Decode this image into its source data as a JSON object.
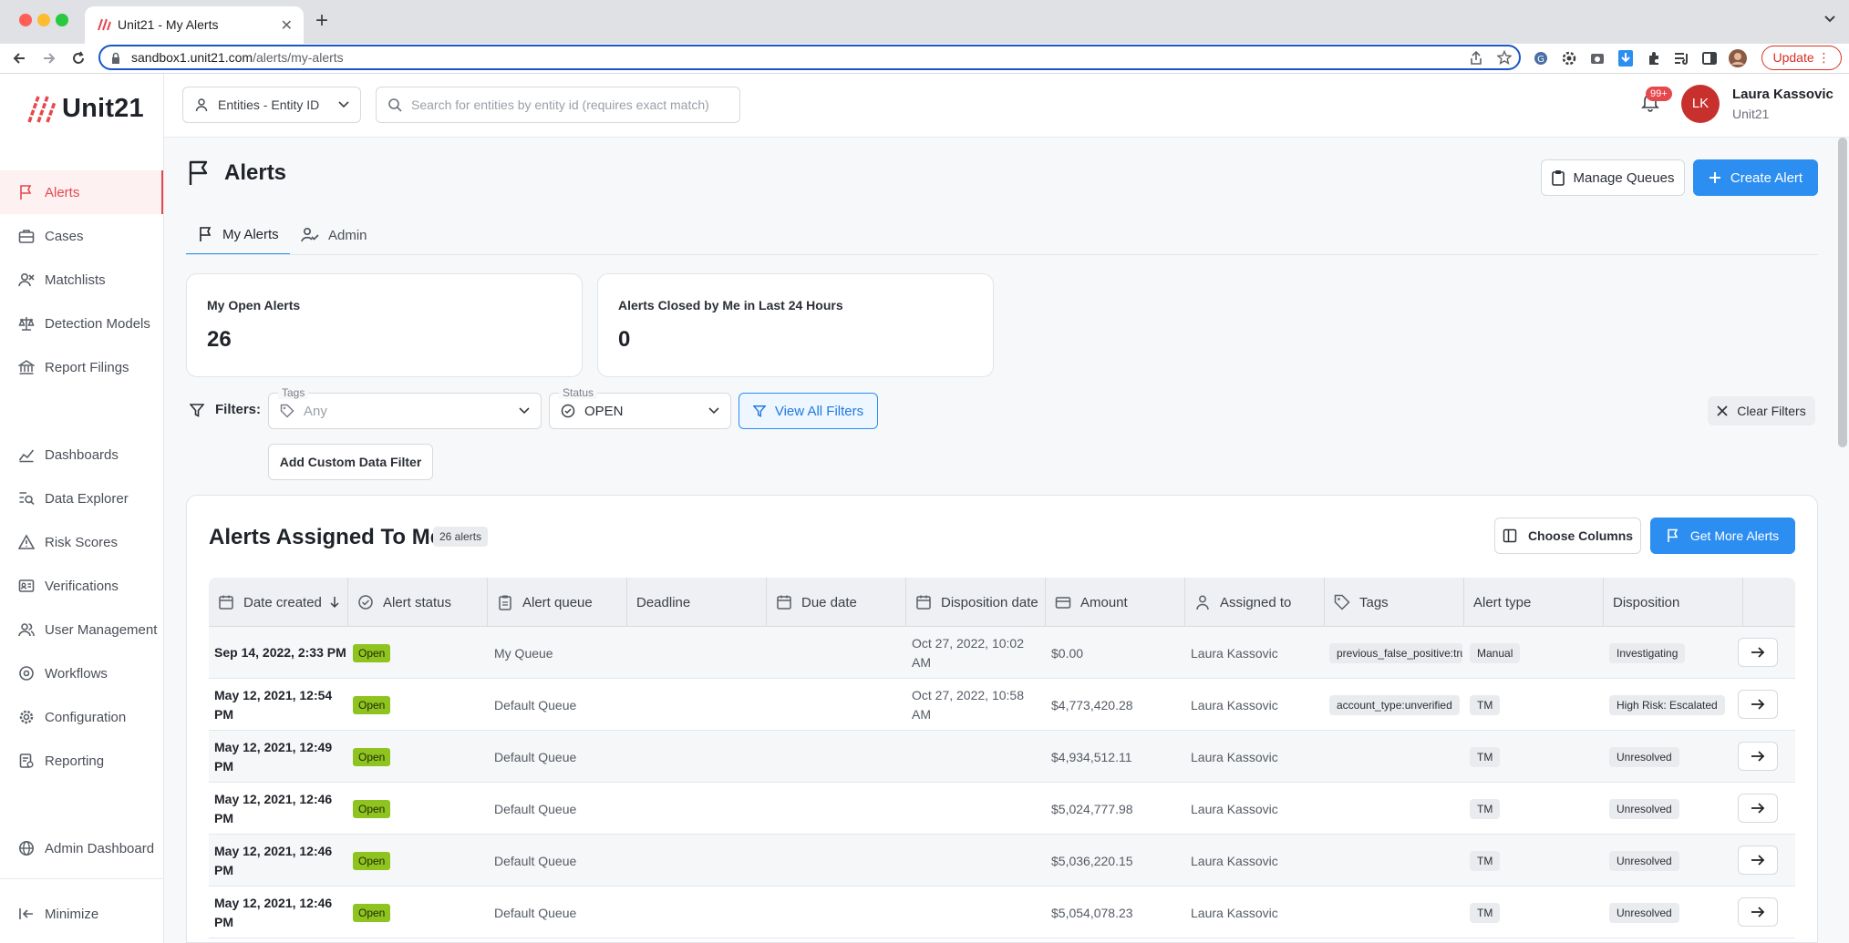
{
  "browser": {
    "tab_title": "Unit21 - My Alerts",
    "url_host": "sandbox1.unit21.com",
    "url_path": "/alerts/my-alerts",
    "update_label": "Update"
  },
  "brand": {
    "name": "Unit21",
    "accent": "#e5484d",
    "primary": "#2b8ef0"
  },
  "sidebar": {
    "items": [
      {
        "label": "Alerts",
        "icon": "flag-icon"
      },
      {
        "label": "Cases",
        "icon": "briefcase-icon"
      },
      {
        "label": "Matchlists",
        "icon": "user-x-icon"
      },
      {
        "label": "Detection Models",
        "icon": "scale-icon"
      },
      {
        "label": "Report Filings",
        "icon": "building-icon"
      },
      {
        "label": "Dashboards",
        "icon": "chart-line-icon"
      },
      {
        "label": "Data Explorer",
        "icon": "search-list-icon"
      },
      {
        "label": "Risk Scores",
        "icon": "warning-icon"
      },
      {
        "label": "Verifications",
        "icon": "id-card-icon"
      },
      {
        "label": "User Management",
        "icon": "users-icon"
      },
      {
        "label": "Workflows",
        "icon": "workflow-icon"
      },
      {
        "label": "Configuration",
        "icon": "gear-icon"
      },
      {
        "label": "Reporting",
        "icon": "report-icon"
      },
      {
        "label": "Admin Dashboard",
        "icon": "globe-icon"
      }
    ],
    "minimize_label": "Minimize"
  },
  "header": {
    "entity_select": "Entities - Entity ID",
    "search_placeholder": "Search for entities by entity id (requires exact match)",
    "notifications": "99+",
    "user_initials": "LK",
    "user_name": "Laura Kassovic",
    "user_org": "Unit21"
  },
  "page": {
    "title": "Alerts",
    "manage_queues": "Manage Queues",
    "create_alert": "Create Alert",
    "tabs": [
      "My Alerts",
      "Admin"
    ]
  },
  "stats": [
    {
      "label": "My Open Alerts",
      "value": "26"
    },
    {
      "label": "Alerts Closed by Me in Last 24 Hours",
      "value": "0"
    }
  ],
  "filters": {
    "label": "Filters:",
    "tags_legend": "Tags",
    "tags_value": "Any",
    "status_legend": "Status",
    "status_value": "OPEN",
    "view_all": "View All Filters",
    "clear": "Clear Filters",
    "add_custom": "Add Custom Data Filter"
  },
  "table": {
    "title": "Alerts Assigned To Me",
    "count": "26 alerts",
    "choose_columns": "Choose Columns",
    "get_more": "Get More Alerts",
    "columns": [
      "Date created",
      "Alert status",
      "Alert queue",
      "Deadline",
      "Due date",
      "Disposition date",
      "Amount",
      "Assigned to",
      "Tags",
      "Alert type",
      "Disposition"
    ],
    "rows": [
      {
        "date1": "Sep 14, 2022, 2:33 PM",
        "date2": "",
        "status": "Open",
        "queue": "My Queue",
        "disp1": "Oct 27, 2022, 10:02",
        "disp2": "AM",
        "amount": "$0.00",
        "assigned": "Laura Kassovic",
        "tag": "previous_false_positive:tru",
        "type": "Manual",
        "disposition": "Investigating"
      },
      {
        "date1": "May 12, 2021, 12:54",
        "date2": "PM",
        "status": "Open",
        "queue": "Default Queue",
        "disp1": "Oct 27, 2022, 10:58",
        "disp2": "AM",
        "amount": "$4,773,420.28",
        "assigned": "Laura Kassovic",
        "tag": "account_type:unverified",
        "type": "TM",
        "disposition": "High Risk: Escalated"
      },
      {
        "date1": "May 12, 2021, 12:49",
        "date2": "PM",
        "status": "Open",
        "queue": "Default Queue",
        "disp1": "",
        "disp2": "",
        "amount": "$4,934,512.11",
        "assigned": "Laura Kassovic",
        "tag": "",
        "type": "TM",
        "disposition": "Unresolved"
      },
      {
        "date1": "May 12, 2021, 12:46",
        "date2": "PM",
        "status": "Open",
        "queue": "Default Queue",
        "disp1": "",
        "disp2": "",
        "amount": "$5,024,777.98",
        "assigned": "Laura Kassovic",
        "tag": "",
        "type": "TM",
        "disposition": "Unresolved"
      },
      {
        "date1": "May 12, 2021, 12:46",
        "date2": "PM",
        "status": "Open",
        "queue": "Default Queue",
        "disp1": "",
        "disp2": "",
        "amount": "$5,036,220.15",
        "assigned": "Laura Kassovic",
        "tag": "",
        "type": "TM",
        "disposition": "Unresolved"
      },
      {
        "date1": "May 12, 2021, 12:46",
        "date2": "PM",
        "status": "Open",
        "queue": "Default Queue",
        "disp1": "",
        "disp2": "",
        "amount": "$5,054,078.23",
        "assigned": "Laura Kassovic",
        "tag": "",
        "type": "TM",
        "disposition": "Unresolved"
      }
    ]
  }
}
